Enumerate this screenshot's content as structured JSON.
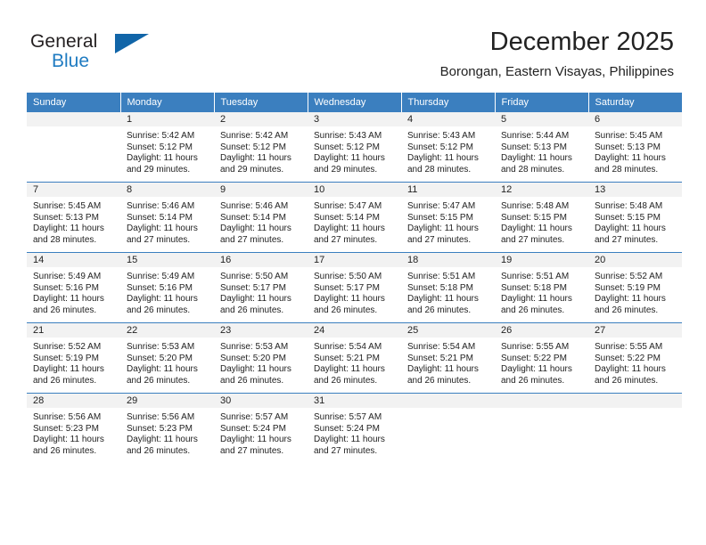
{
  "brand": {
    "name_part1": "General",
    "name_part2": "Blue",
    "logo_icon": "triangle-flag-icon"
  },
  "header": {
    "title": "December 2025",
    "subtitle": "Borongan, Eastern Visayas, Philippines"
  },
  "calendar": {
    "weekday_headers": [
      "Sunday",
      "Monday",
      "Tuesday",
      "Wednesday",
      "Thursday",
      "Friday",
      "Saturday"
    ],
    "colors": {
      "header_bg": "#3b7fbf",
      "header_text": "#ffffff",
      "daynum_bg": "#f2f2f2",
      "brand_blue": "#1f7bc1",
      "logo_blue": "#1165a8",
      "text": "#222222"
    },
    "weeks": [
      [
        {
          "day": "",
          "sunrise": "",
          "sunset": "",
          "daylight1": "",
          "daylight2": ""
        },
        {
          "day": "1",
          "sunrise": "Sunrise: 5:42 AM",
          "sunset": "Sunset: 5:12 PM",
          "daylight1": "Daylight: 11 hours",
          "daylight2": "and 29 minutes."
        },
        {
          "day": "2",
          "sunrise": "Sunrise: 5:42 AM",
          "sunset": "Sunset: 5:12 PM",
          "daylight1": "Daylight: 11 hours",
          "daylight2": "and 29 minutes."
        },
        {
          "day": "3",
          "sunrise": "Sunrise: 5:43 AM",
          "sunset": "Sunset: 5:12 PM",
          "daylight1": "Daylight: 11 hours",
          "daylight2": "and 29 minutes."
        },
        {
          "day": "4",
          "sunrise": "Sunrise: 5:43 AM",
          "sunset": "Sunset: 5:12 PM",
          "daylight1": "Daylight: 11 hours",
          "daylight2": "and 28 minutes."
        },
        {
          "day": "5",
          "sunrise": "Sunrise: 5:44 AM",
          "sunset": "Sunset: 5:13 PM",
          "daylight1": "Daylight: 11 hours",
          "daylight2": "and 28 minutes."
        },
        {
          "day": "6",
          "sunrise": "Sunrise: 5:45 AM",
          "sunset": "Sunset: 5:13 PM",
          "daylight1": "Daylight: 11 hours",
          "daylight2": "and 28 minutes."
        }
      ],
      [
        {
          "day": "7",
          "sunrise": "Sunrise: 5:45 AM",
          "sunset": "Sunset: 5:13 PM",
          "daylight1": "Daylight: 11 hours",
          "daylight2": "and 28 minutes."
        },
        {
          "day": "8",
          "sunrise": "Sunrise: 5:46 AM",
          "sunset": "Sunset: 5:14 PM",
          "daylight1": "Daylight: 11 hours",
          "daylight2": "and 27 minutes."
        },
        {
          "day": "9",
          "sunrise": "Sunrise: 5:46 AM",
          "sunset": "Sunset: 5:14 PM",
          "daylight1": "Daylight: 11 hours",
          "daylight2": "and 27 minutes."
        },
        {
          "day": "10",
          "sunrise": "Sunrise: 5:47 AM",
          "sunset": "Sunset: 5:14 PM",
          "daylight1": "Daylight: 11 hours",
          "daylight2": "and 27 minutes."
        },
        {
          "day": "11",
          "sunrise": "Sunrise: 5:47 AM",
          "sunset": "Sunset: 5:15 PM",
          "daylight1": "Daylight: 11 hours",
          "daylight2": "and 27 minutes."
        },
        {
          "day": "12",
          "sunrise": "Sunrise: 5:48 AM",
          "sunset": "Sunset: 5:15 PM",
          "daylight1": "Daylight: 11 hours",
          "daylight2": "and 27 minutes."
        },
        {
          "day": "13",
          "sunrise": "Sunrise: 5:48 AM",
          "sunset": "Sunset: 5:15 PM",
          "daylight1": "Daylight: 11 hours",
          "daylight2": "and 27 minutes."
        }
      ],
      [
        {
          "day": "14",
          "sunrise": "Sunrise: 5:49 AM",
          "sunset": "Sunset: 5:16 PM",
          "daylight1": "Daylight: 11 hours",
          "daylight2": "and 26 minutes."
        },
        {
          "day": "15",
          "sunrise": "Sunrise: 5:49 AM",
          "sunset": "Sunset: 5:16 PM",
          "daylight1": "Daylight: 11 hours",
          "daylight2": "and 26 minutes."
        },
        {
          "day": "16",
          "sunrise": "Sunrise: 5:50 AM",
          "sunset": "Sunset: 5:17 PM",
          "daylight1": "Daylight: 11 hours",
          "daylight2": "and 26 minutes."
        },
        {
          "day": "17",
          "sunrise": "Sunrise: 5:50 AM",
          "sunset": "Sunset: 5:17 PM",
          "daylight1": "Daylight: 11 hours",
          "daylight2": "and 26 minutes."
        },
        {
          "day": "18",
          "sunrise": "Sunrise: 5:51 AM",
          "sunset": "Sunset: 5:18 PM",
          "daylight1": "Daylight: 11 hours",
          "daylight2": "and 26 minutes."
        },
        {
          "day": "19",
          "sunrise": "Sunrise: 5:51 AM",
          "sunset": "Sunset: 5:18 PM",
          "daylight1": "Daylight: 11 hours",
          "daylight2": "and 26 minutes."
        },
        {
          "day": "20",
          "sunrise": "Sunrise: 5:52 AM",
          "sunset": "Sunset: 5:19 PM",
          "daylight1": "Daylight: 11 hours",
          "daylight2": "and 26 minutes."
        }
      ],
      [
        {
          "day": "21",
          "sunrise": "Sunrise: 5:52 AM",
          "sunset": "Sunset: 5:19 PM",
          "daylight1": "Daylight: 11 hours",
          "daylight2": "and 26 minutes."
        },
        {
          "day": "22",
          "sunrise": "Sunrise: 5:53 AM",
          "sunset": "Sunset: 5:20 PM",
          "daylight1": "Daylight: 11 hours",
          "daylight2": "and 26 minutes."
        },
        {
          "day": "23",
          "sunrise": "Sunrise: 5:53 AM",
          "sunset": "Sunset: 5:20 PM",
          "daylight1": "Daylight: 11 hours",
          "daylight2": "and 26 minutes."
        },
        {
          "day": "24",
          "sunrise": "Sunrise: 5:54 AM",
          "sunset": "Sunset: 5:21 PM",
          "daylight1": "Daylight: 11 hours",
          "daylight2": "and 26 minutes."
        },
        {
          "day": "25",
          "sunrise": "Sunrise: 5:54 AM",
          "sunset": "Sunset: 5:21 PM",
          "daylight1": "Daylight: 11 hours",
          "daylight2": "and 26 minutes."
        },
        {
          "day": "26",
          "sunrise": "Sunrise: 5:55 AM",
          "sunset": "Sunset: 5:22 PM",
          "daylight1": "Daylight: 11 hours",
          "daylight2": "and 26 minutes."
        },
        {
          "day": "27",
          "sunrise": "Sunrise: 5:55 AM",
          "sunset": "Sunset: 5:22 PM",
          "daylight1": "Daylight: 11 hours",
          "daylight2": "and 26 minutes."
        }
      ],
      [
        {
          "day": "28",
          "sunrise": "Sunrise: 5:56 AM",
          "sunset": "Sunset: 5:23 PM",
          "daylight1": "Daylight: 11 hours",
          "daylight2": "and 26 minutes."
        },
        {
          "day": "29",
          "sunrise": "Sunrise: 5:56 AM",
          "sunset": "Sunset: 5:23 PM",
          "daylight1": "Daylight: 11 hours",
          "daylight2": "and 26 minutes."
        },
        {
          "day": "30",
          "sunrise": "Sunrise: 5:57 AM",
          "sunset": "Sunset: 5:24 PM",
          "daylight1": "Daylight: 11 hours",
          "daylight2": "and 27 minutes."
        },
        {
          "day": "31",
          "sunrise": "Sunrise: 5:57 AM",
          "sunset": "Sunset: 5:24 PM",
          "daylight1": "Daylight: 11 hours",
          "daylight2": "and 27 minutes."
        },
        {
          "day": "",
          "sunrise": "",
          "sunset": "",
          "daylight1": "",
          "daylight2": ""
        },
        {
          "day": "",
          "sunrise": "",
          "sunset": "",
          "daylight1": "",
          "daylight2": ""
        },
        {
          "day": "",
          "sunrise": "",
          "sunset": "",
          "daylight1": "",
          "daylight2": ""
        }
      ]
    ]
  }
}
